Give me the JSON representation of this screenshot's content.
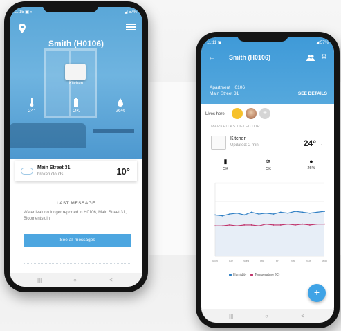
{
  "phone1": {
    "status_left": "11:15 ▣ ◐",
    "status_right": "◢ 57%",
    "title": "Smith (H0106)",
    "sensor_label": "Kitchen",
    "stats": [
      {
        "icon": "thermometer-icon",
        "value": "24°"
      },
      {
        "icon": "battery-icon",
        "value": "OK"
      },
      {
        "icon": "drop-icon",
        "value": "26%"
      }
    ],
    "weather": {
      "street": "Main Street 31",
      "condition": "broken clouds",
      "temp": "10°"
    },
    "last_message": {
      "title": "LAST MESSAGE",
      "text": "Water leak no longer reported in H0106, Main Street 31, Bloomentstuin"
    },
    "see_all_label": "See all messages",
    "nav": [
      "|||",
      "○",
      "<"
    ]
  },
  "phone2": {
    "status_left": "11:11 ▣",
    "status_right": "◢ 57%",
    "back_icon": "←",
    "title": "Smith (H0106)",
    "apartment_line1": "Apartment H0106",
    "apartment_line2": "Main Street 31",
    "see_details_label": "SEE DETAILS",
    "lives_here_label": "Lives here:",
    "add_icon": "+",
    "devices_header": "MARKED AS DETECTOR",
    "room": {
      "name": "Kitchen",
      "updated": "Updated: 2 min",
      "temp": "24°"
    },
    "room_stats": [
      {
        "icon": "battery-icon",
        "glyph": "▮",
        "value": "OK"
      },
      {
        "icon": "wifi-icon",
        "glyph": "≋",
        "value": "OK"
      },
      {
        "icon": "drop-icon",
        "glyph": "●",
        "value": "26%"
      }
    ],
    "legend": [
      {
        "label": "Humidity",
        "color": "#2f7fc4"
      },
      {
        "label": "Temperature (C)",
        "color": "#c0336b"
      }
    ],
    "fab_label": "+",
    "nav": [
      "|||",
      "○",
      "<"
    ]
  },
  "chart_data": {
    "type": "line",
    "x": [
      "Mon",
      "Tue",
      "Wed",
      "Thu",
      "Fri",
      "Sat",
      "Sun",
      "Mon"
    ],
    "series": [
      {
        "name": "Humidity",
        "values": [
          45,
          44,
          46,
          47,
          45,
          48,
          46,
          47,
          46,
          48,
          47,
          49,
          48,
          47,
          48,
          49
        ],
        "color": "#2f7fc4"
      },
      {
        "name": "Temperature (C)",
        "values": [
          33,
          33,
          34,
          33,
          34,
          34,
          33,
          35,
          34,
          34,
          35,
          34,
          35,
          34,
          35,
          35
        ],
        "color": "#c0336b"
      }
    ],
    "ylim": [
      0,
      80
    ],
    "grid": true,
    "legend": "bottom"
  }
}
